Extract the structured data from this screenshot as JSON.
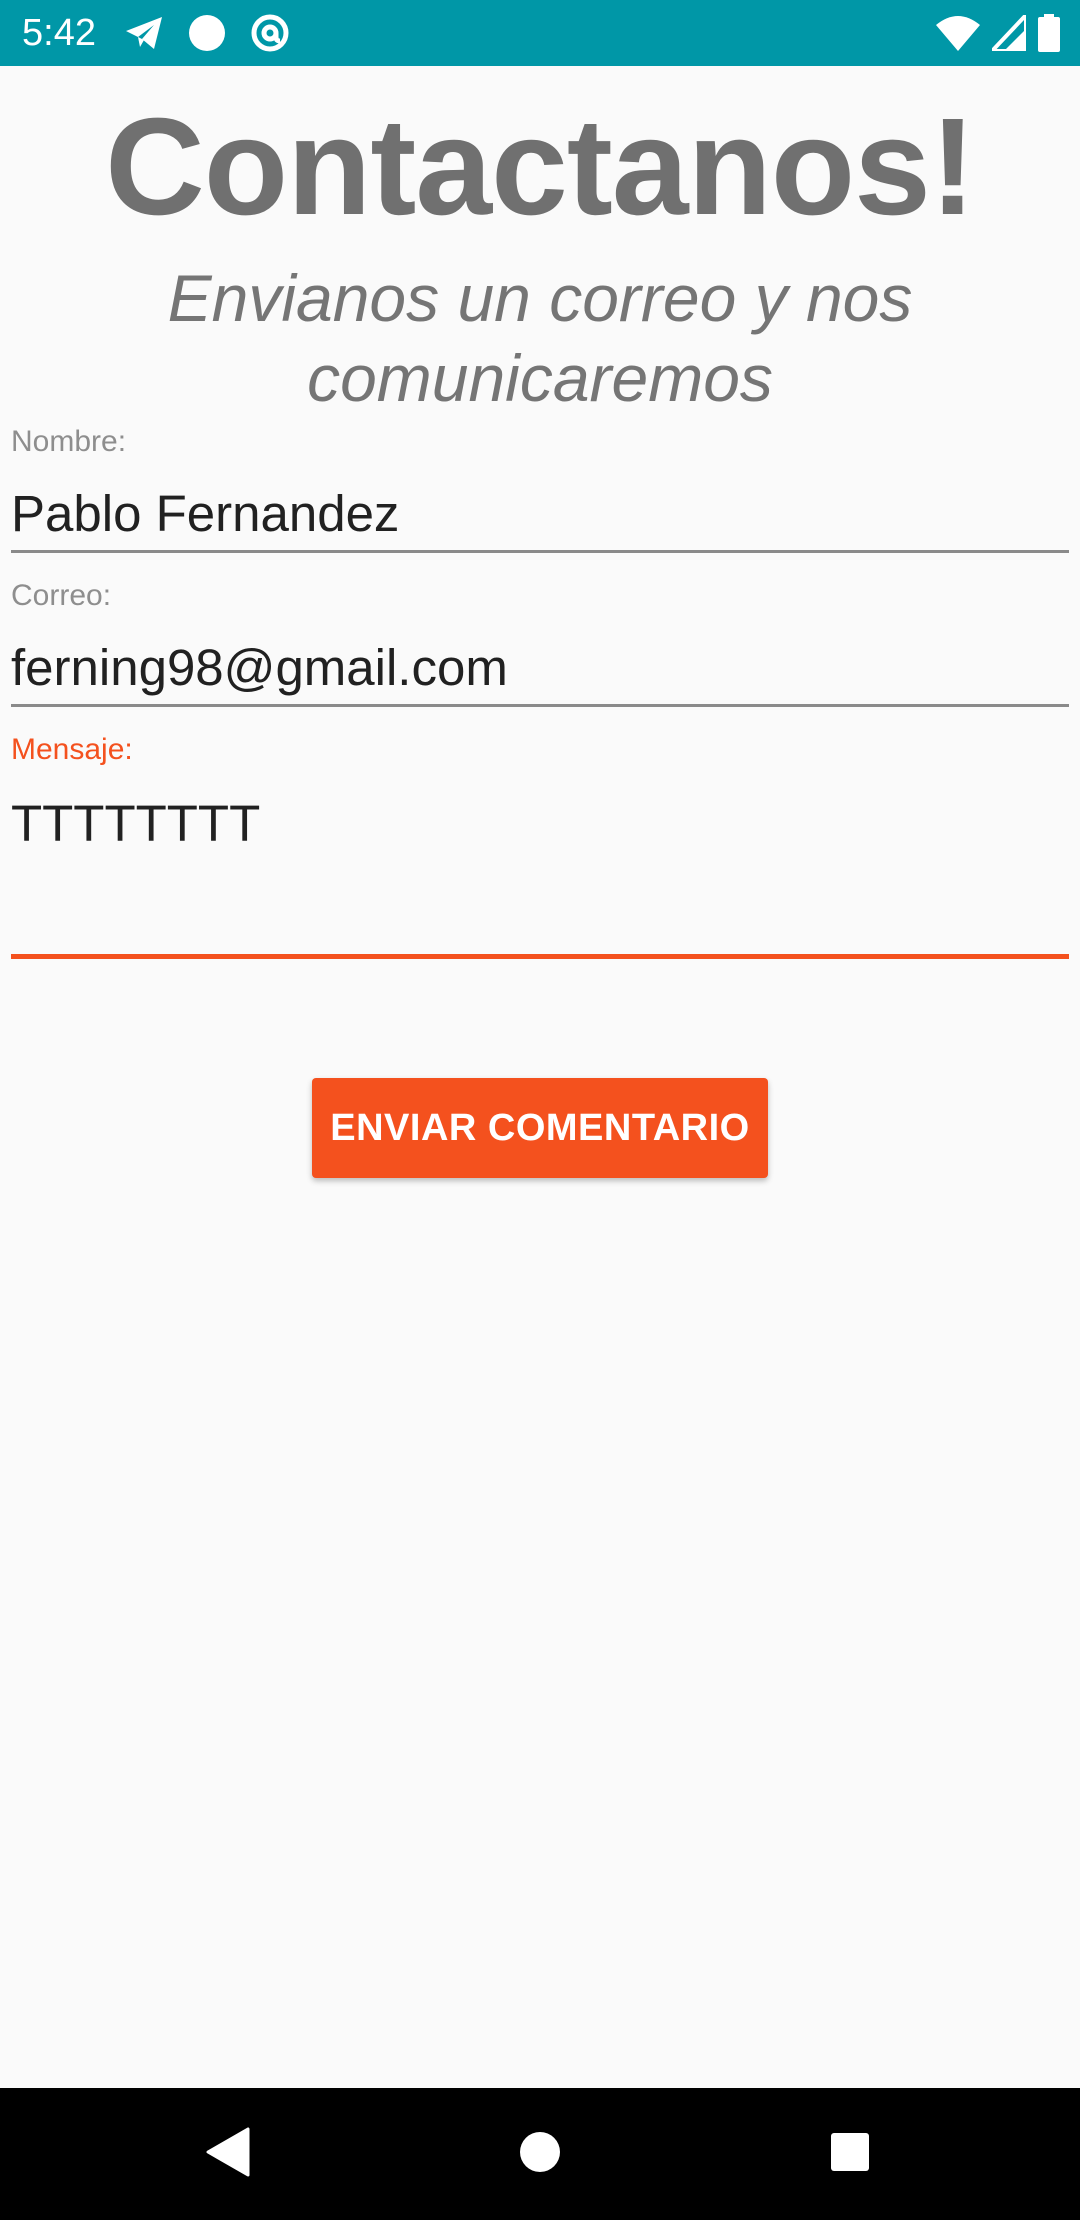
{
  "status_bar": {
    "time": "5:42",
    "background_color": "#0097a7",
    "left_icons": [
      "telegram-icon",
      "circle-icon",
      "at-sign-icon"
    ],
    "right_icons": [
      "wifi-icon",
      "signal-icon",
      "battery-icon"
    ]
  },
  "header": {
    "title": "Contactanos!",
    "subtitle": "Envianos un correo y nos comunicaremos"
  },
  "form": {
    "nombre": {
      "label": "Nombre:",
      "value": "Pablo Fernandez"
    },
    "correo": {
      "label": "Correo:",
      "value": "ferning98@gmail.com"
    },
    "mensaje": {
      "label": "Mensaje:",
      "value": "TTTTTTTT",
      "focused": true
    },
    "submit_label": "ENVIAR COMENTARIO"
  },
  "colors": {
    "accent": "#f4511e",
    "title_text": "#707070",
    "status_bar": "#0097a7"
  },
  "nav_bar": {
    "buttons": [
      "back-icon",
      "home-icon",
      "recents-icon"
    ]
  }
}
